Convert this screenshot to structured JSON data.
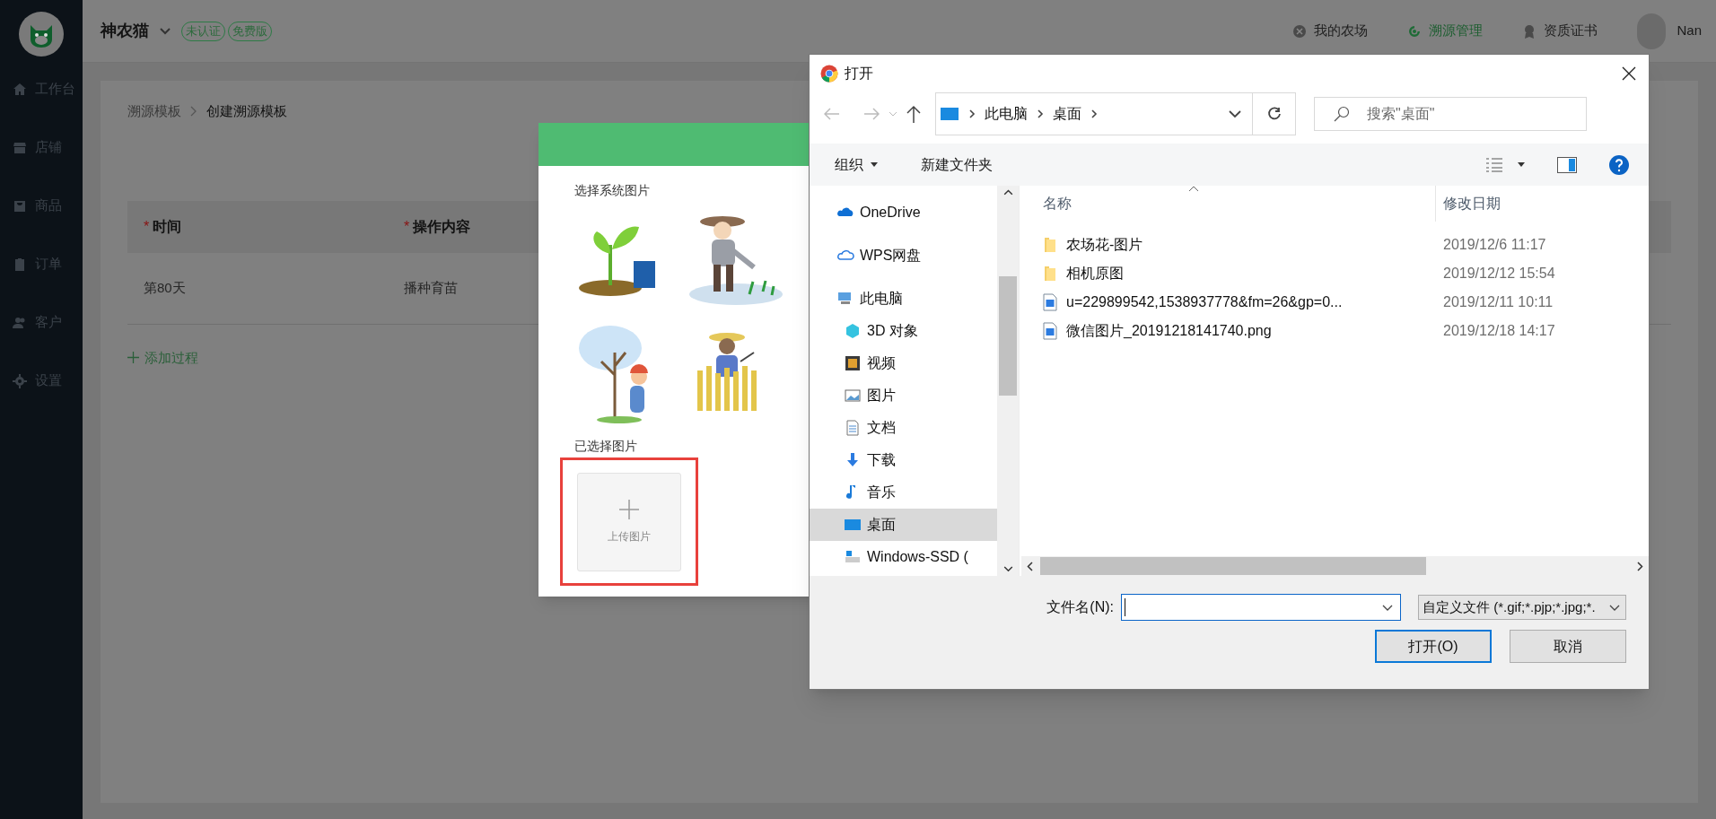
{
  "app": {
    "brand": "神农猫",
    "badges": [
      "未认证",
      "免费版"
    ],
    "top_nav": [
      {
        "label": "我的农场",
        "selected": false
      },
      {
        "label": "溯源管理",
        "selected": true
      },
      {
        "label": "资质证书",
        "selected": false
      }
    ],
    "user": "Nan",
    "sidebar": [
      "工作台",
      "店铺",
      "商品",
      "订单",
      "客户",
      "设置"
    ],
    "breadcrumb": [
      "溯源模板",
      "创建溯源模板"
    ],
    "table": {
      "columns": [
        {
          "label": "时间",
          "marker": "*"
        },
        {
          "label": "操作内容",
          "marker": "*"
        }
      ],
      "rows": [
        [
          "第80天",
          "播种育苗"
        ]
      ]
    },
    "add_button": "添加过程"
  },
  "image_picker": {
    "system_label": "选择系统图片",
    "selected_label": "已选择图片",
    "upload_label": "上传图片"
  },
  "file_dialog": {
    "title": "打开",
    "path": [
      "此电脑",
      "桌面"
    ],
    "search_placeholder": "搜索\"桌面\"",
    "toolbar": [
      "组织",
      "新建文件夹"
    ],
    "nav": [
      {
        "label": "OneDrive",
        "selected": false
      },
      {
        "label": "WPS网盘",
        "selected": false
      },
      {
        "label": "此电脑",
        "selected": false,
        "children": [
          {
            "label": "3D 对象",
            "selected": false
          },
          {
            "label": "视频",
            "selected": false
          },
          {
            "label": "图片",
            "selected": false
          },
          {
            "label": "文档",
            "selected": false
          },
          {
            "label": "下载",
            "selected": false
          },
          {
            "label": "音乐",
            "selected": false
          },
          {
            "label": "桌面",
            "selected": true
          },
          {
            "label": "Windows-SSD (",
            "selected": false
          }
        ]
      }
    ],
    "columns": [
      "名称",
      "修改日期"
    ],
    "files": [
      {
        "kind": "folder",
        "name": "农场花-图片",
        "date": "2019/12/6 11:17"
      },
      {
        "kind": "folder",
        "name": "相机原图",
        "date": "2019/12/12 15:54"
      },
      {
        "kind": "image",
        "name": "u=229899542,1538937778&fm=26&gp=0...",
        "date": "2019/12/11 10:11"
      },
      {
        "kind": "image",
        "name": "微信图片_20191218141740.png",
        "date": "2019/12/18 14:17"
      }
    ],
    "filename_label": "文件名(N):",
    "filter": "自定义文件 (*.gif;*.pjp;*.jpg;*.",
    "buttons": [
      "打开(O)",
      "取消"
    ]
  }
}
